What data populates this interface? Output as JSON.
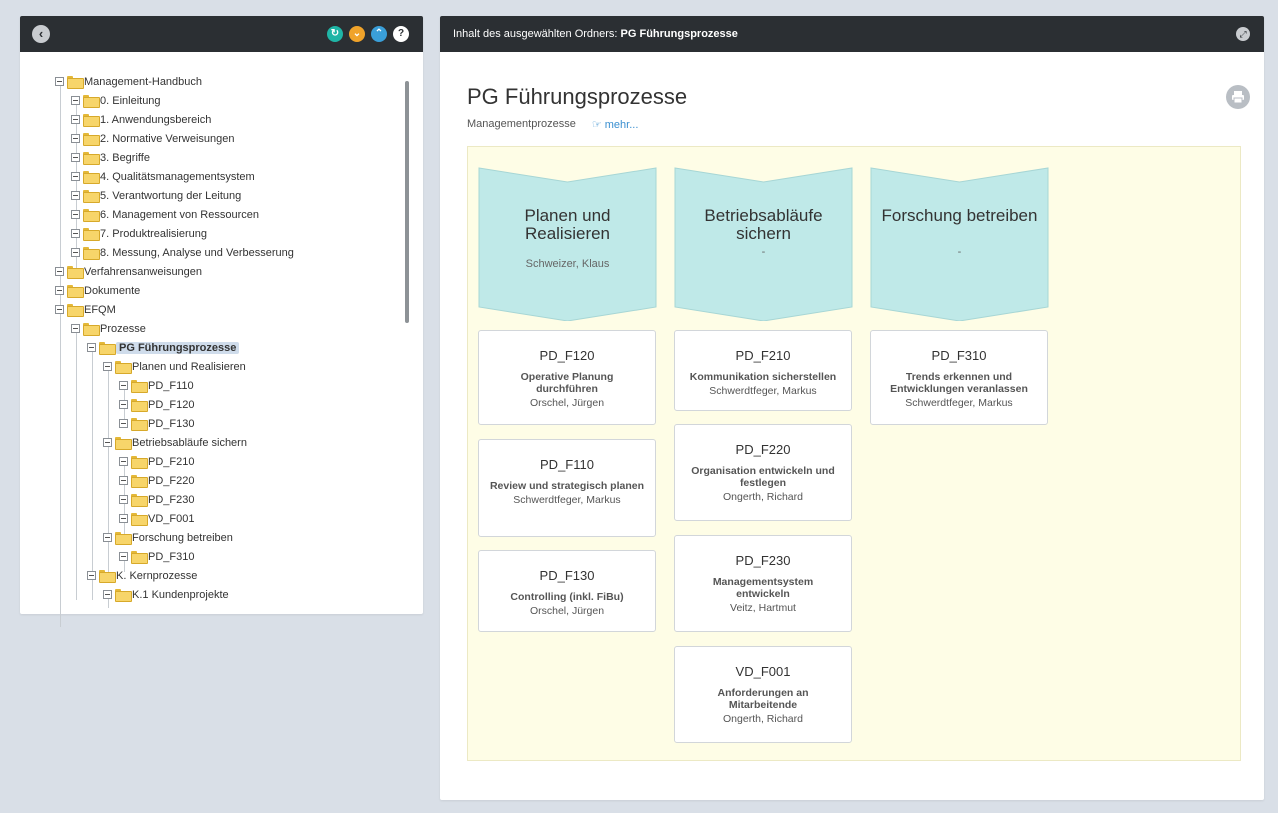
{
  "left_header": {
    "back_icon": "chevron-left-icon",
    "buttons": [
      {
        "icon": "refresh-icon",
        "glyph": "↻",
        "color": "#1fb5a6"
      },
      {
        "icon": "chevron-down-icon",
        "glyph": "⌄",
        "color": "#f0a32a"
      },
      {
        "icon": "chevron-up-icon",
        "glyph": "⌃",
        "color": "#3a9fd9"
      },
      {
        "icon": "help-icon",
        "glyph": "?",
        "color": "#ffffff"
      }
    ]
  },
  "tree": {
    "items": [
      {
        "label": "Management-Handbuch",
        "level": 0
      },
      {
        "label": "0. Einleitung",
        "level": 1
      },
      {
        "label": "1. Anwendungsbereich",
        "level": 1
      },
      {
        "label": "2. Normative Verweisungen",
        "level": 1
      },
      {
        "label": "3. Begriffe",
        "level": 1
      },
      {
        "label": "4. Qualitätsmanagementsystem",
        "level": 1
      },
      {
        "label": "5. Verantwortung der Leitung",
        "level": 1
      },
      {
        "label": "6. Management von Ressourcen",
        "level": 1
      },
      {
        "label": "7. Produktrealisierung",
        "level": 1
      },
      {
        "label": "8. Messung, Analyse und Verbesserung",
        "level": 1
      },
      {
        "label": "Verfahrensanweisungen",
        "level": 0
      },
      {
        "label": "Dokumente",
        "level": 0
      },
      {
        "label": "EFQM",
        "level": 0
      },
      {
        "label": "Prozesse",
        "level": 1
      },
      {
        "label": "PG Führungsprozesse",
        "level": 2,
        "selected": true
      },
      {
        "label": "Planen und Realisieren",
        "level": 3
      },
      {
        "label": "PD_F110",
        "level": 4
      },
      {
        "label": "PD_F120",
        "level": 4
      },
      {
        "label": "PD_F130",
        "level": 4
      },
      {
        "label": "Betriebsabläufe sichern",
        "level": 3
      },
      {
        "label": "PD_F210",
        "level": 4
      },
      {
        "label": "PD_F220",
        "level": 4
      },
      {
        "label": "PD_F230",
        "level": 4
      },
      {
        "label": "VD_F001",
        "level": 4
      },
      {
        "label": "Forschung betreiben",
        "level": 3
      },
      {
        "label": "PD_F310",
        "level": 4
      },
      {
        "label": "K. Kernprozesse",
        "level": 2
      },
      {
        "label": "K.1 Kundenprojekte",
        "level": 3
      }
    ]
  },
  "right_header": {
    "prefix": "Inhalt des ausgewählten Ordners: ",
    "folder": "PG Führungsprozesse",
    "expand_icon": "expand-icon"
  },
  "page": {
    "title": "PG Führungsprozesse",
    "category": "Managementprozesse",
    "more_label": "☞ mehr...",
    "print_icon": "print-icon"
  },
  "columns": [
    {
      "title": "Planen und Realisieren",
      "owner": "Schweizer, Klaus",
      "cards": [
        {
          "code": "PD_F120",
          "title": "Operative Planung durchführen",
          "owner": "Orschel, Jürgen"
        },
        {
          "code": "PD_F110",
          "title": "Review und strategisch planen",
          "owner": "Schwerdtfeger, Markus"
        },
        {
          "code": "PD_F130",
          "title": "Controlling (inkl. FiBu)",
          "owner": "Orschel, Jürgen"
        }
      ]
    },
    {
      "title": "Betriebsabläufe sichern",
      "owner": "-",
      "cards": [
        {
          "code": "PD_F210",
          "title": "Kommunikation sicherstellen",
          "owner": "Schwerdtfeger, Markus"
        },
        {
          "code": "PD_F220",
          "title": "Organisation entwickeln und festlegen",
          "owner": "Ongerth, Richard"
        },
        {
          "code": "PD_F230",
          "title": "Managementsystem entwickeln",
          "owner": "Veitz, Hartmut"
        },
        {
          "code": "VD_F001",
          "title": "Anforderungen an Mitarbeitende",
          "owner": "Ongerth, Richard"
        }
      ]
    },
    {
      "title": "Forschung betreiben",
      "owner": "-",
      "cards": [
        {
          "code": "PD_F310",
          "title": "Trends erkennen und Entwicklungen veranlassen",
          "owner": "Schwerdtfeger, Markus"
        }
      ]
    }
  ],
  "colors": {
    "header_bg": "#2b2f33",
    "chevron_fill": "#bfe9e8",
    "canvas_bg": "#fefde6",
    "selected_bg": "#cfdceb",
    "link": "#3a8fd0"
  }
}
